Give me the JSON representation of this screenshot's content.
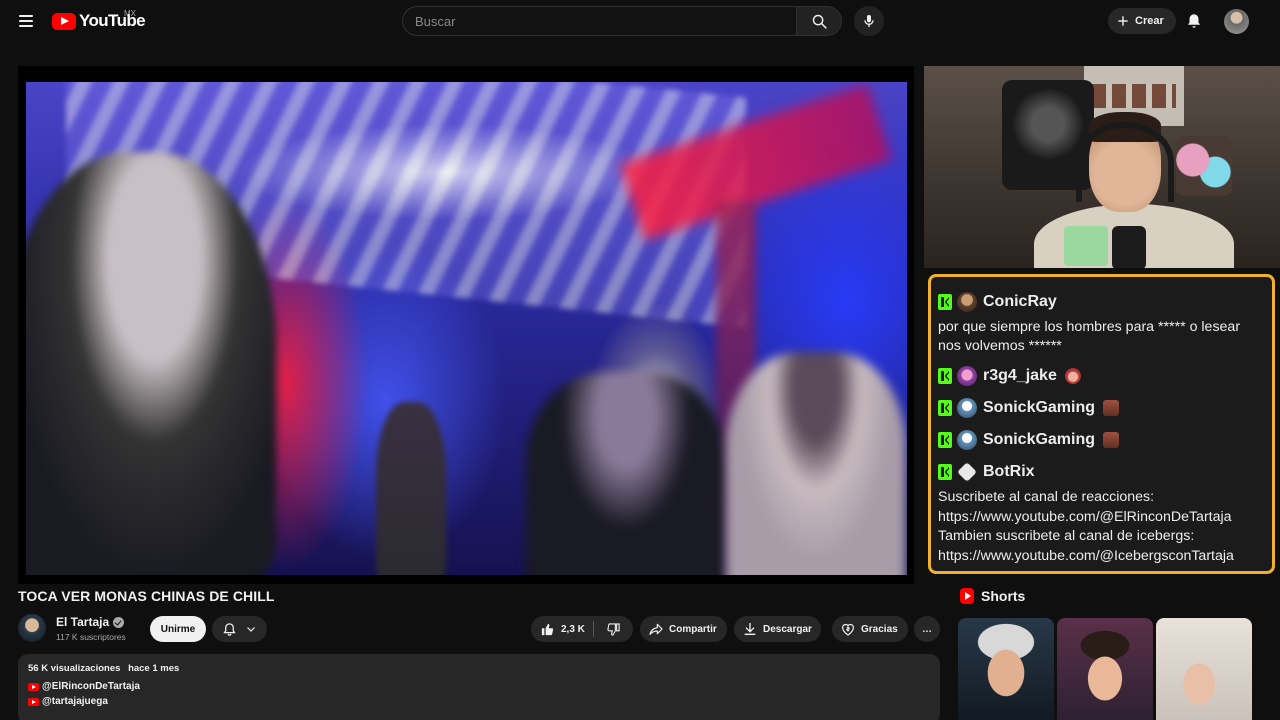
{
  "header": {
    "logo_text": "YouTube",
    "country": "MX",
    "search_placeholder": "Buscar",
    "create_label": "Crear"
  },
  "video": {
    "title": "TOCA VER MONAS CHINAS DE CHILL",
    "channel_name": "El Tartaja",
    "subscribers": "117 K suscriptores",
    "join_label": "Unirme",
    "likes": "2,3 K",
    "share_label": "Compartir",
    "download_label": "Descargar",
    "thanks_label": "Gracias",
    "more_label": "…"
  },
  "description": {
    "views": "56 K visualizaciones",
    "date": "hace 1 mes",
    "links": [
      "@ElRinconDeTartaja",
      "@tartajajuega"
    ]
  },
  "chat": {
    "messages": [
      {
        "user": "ConicRay",
        "text": "por que siempre los hombres para ***** o lesear nos volvemos ******"
      },
      {
        "user": "r3g4_jake"
      },
      {
        "user": "SonickGaming"
      },
      {
        "user": "SonickGaming"
      },
      {
        "user": "BotRix",
        "text": "Suscribete al canal de reacciones: https://www.youtube.com/@ElRinconDeTartaja Tambien suscribete al canal de icebergs: https://www.youtube.com/@IcebergsconTartaja"
      }
    ]
  },
  "shorts": {
    "title": "Shorts"
  },
  "colors": {
    "background": "#0f0f0f",
    "brand_red": "#ff0000",
    "chat_border": "#f2b12a",
    "kick_green": "#53fc18",
    "pill_bg": "#272727"
  },
  "icons": {
    "menu": "hamburger-icon",
    "search": "search-icon",
    "mic": "microphone-icon",
    "create": "plus-icon",
    "bell": "bell-icon",
    "like": "thumbs-up-icon",
    "dislike": "thumbs-down-icon",
    "share": "share-arrow-icon",
    "download": "download-icon",
    "thanks": "heart-dollar-icon"
  }
}
